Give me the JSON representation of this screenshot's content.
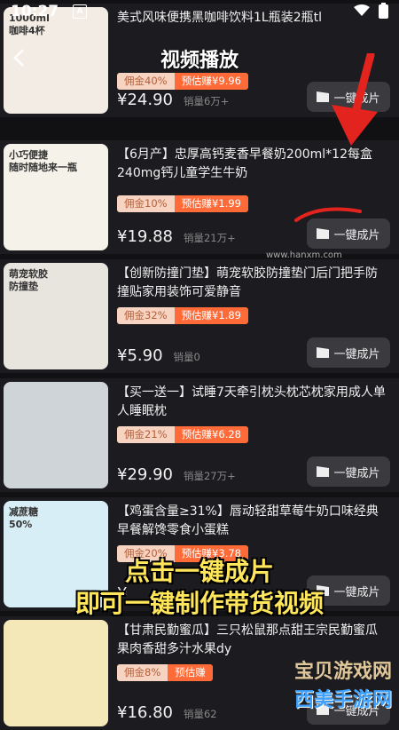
{
  "status": {
    "time": "10:27",
    "app_badge": "A"
  },
  "overlay": {
    "title": "视频播放",
    "caption_line1": "点击一键成片",
    "caption_line2": "即可一键制作带货视频",
    "url": "www.hanxm.com",
    "watermark_line1": "宝贝游戏网",
    "watermark_line2": "西美手游网"
  },
  "button_label": "一键成片",
  "products": [
    {
      "title": "美式风味便携黑咖啡饮料1L瓶装2瓶tl",
      "commission": "佣金40%",
      "estimate": "预估赚¥9.96",
      "price": "¥24.90",
      "sales": "销量6万+",
      "thumb_text": "1000ml\n咖啡4杯",
      "thumb_color": "#f3ece4"
    },
    {
      "title": "【6月产】忠厚高钙麦香早餐奶200ml*12每盒240mg钙儿童学生牛奶",
      "commission": "佣金10%",
      "estimate": "预估赚¥1.99",
      "price": "¥19.88",
      "sales": "销量21万+",
      "thumb_text": "小巧便捷\n随时随地来一瓶",
      "thumb_color": "#f5f2ea"
    },
    {
      "title": "【创新防撞门垫】萌宠软胶防撞垫门后门把手防撞贴家用装饰可爱静音",
      "commission": "佣金32%",
      "estimate": "预估赚¥1.89",
      "price": "¥5.90",
      "sales": "销量0",
      "thumb_text": "萌宠软胶\n防撞垫",
      "thumb_color": "#e8e4de"
    },
    {
      "title": "【买一送一】试睡7天牵引枕头枕芯枕家用成人单人睡眠枕",
      "commission": "佣金21%",
      "estimate": "预估赚¥6.28",
      "price": "¥29.90",
      "sales": "销量27万+",
      "thumb_text": "",
      "thumb_color": "#cfd4d8"
    },
    {
      "title": "【鸡蛋含量≥31%】唇动轻甜草莓牛奶口味经典早餐解馋零食小蛋糕",
      "commission": "佣金20%",
      "estimate": "预估赚¥3.78",
      "price": "¥",
      "sales": "",
      "thumb_text": "减蔗糖\n50%",
      "thumb_color": "#d8eef6"
    },
    {
      "title": "【甘肃民勤蜜瓜】三只松鼠那点甜王宗民勤蜜瓜果肉香甜多汁水果dy",
      "commission": "佣金8%",
      "estimate": "预估赚",
      "price": "¥16.80",
      "sales": "销量62",
      "thumb_text": "",
      "thumb_color": "#f4e7b8"
    }
  ]
}
